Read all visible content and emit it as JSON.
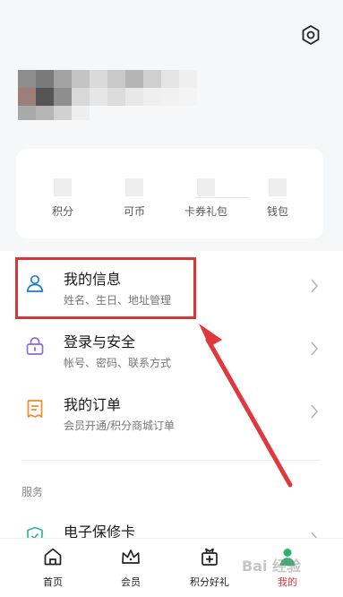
{
  "header": {
    "settings_icon": "hexagon-settings-icon"
  },
  "stats": [
    {
      "label": "积分"
    },
    {
      "label": "可币"
    },
    {
      "label": "卡券礼包"
    },
    {
      "label": "钱包"
    }
  ],
  "list": [
    {
      "title": "我的信息",
      "subtitle": "姓名、生日、地址管理",
      "icon": "user-icon",
      "icon_color": "#1f7fc9"
    },
    {
      "title": "登录与安全",
      "subtitle": "帐号、密码、联系方式",
      "icon": "lock-icon",
      "icon_color": "#8f6ad8"
    },
    {
      "title": "我的订单",
      "subtitle": "会员开通/积分商城订单",
      "icon": "order-icon",
      "icon_color": "#f08c2a"
    }
  ],
  "section": {
    "title": "服务"
  },
  "service_row": {
    "title": "电子保修卡",
    "icon": "shield-icon",
    "icon_color": "#2fb89a"
  },
  "tabs": [
    {
      "label": "首页",
      "icon": "home-icon"
    },
    {
      "label": "会员",
      "icon": "crown-icon"
    },
    {
      "label": "积分好礼",
      "icon": "gift-icon"
    },
    {
      "label": "我的",
      "icon": "profile-icon",
      "active": true
    }
  ],
  "watermark": "Bai 经验",
  "colors": {
    "accent": "#d9363a",
    "active_icon": "#2fb06f"
  }
}
